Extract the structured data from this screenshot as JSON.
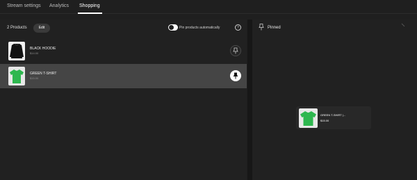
{
  "tabs": [
    {
      "label": "Stream settings",
      "active": false
    },
    {
      "label": "Analytics",
      "active": false
    },
    {
      "label": "Shopping",
      "active": true
    }
  ],
  "left_panel": {
    "product_count": "2 Products",
    "edit_label": "Edit",
    "pin_auto_label": "Pin products automatically",
    "pin_auto_enabled": true,
    "products": [
      {
        "name": "BLACK HOODIE",
        "price": "$14.00",
        "color": "#111111",
        "pinned": false,
        "icon": "pin-outline-icon"
      },
      {
        "name": "GREEN T-SHIRT",
        "price": "$15.00",
        "color": "#2eb74f",
        "pinned": true,
        "icon": "pin-filled-icon"
      }
    ]
  },
  "right_panel": {
    "title": "Pinned",
    "pinned_product": {
      "name": "GREEN T-SHIRT |...",
      "price": "$15.00",
      "color": "#2eb74f"
    }
  },
  "colors": {
    "background": "#1f1f1f",
    "selected_row": "#454545",
    "accent": "#ffffff",
    "tshirt_green": "#2eb74f"
  }
}
